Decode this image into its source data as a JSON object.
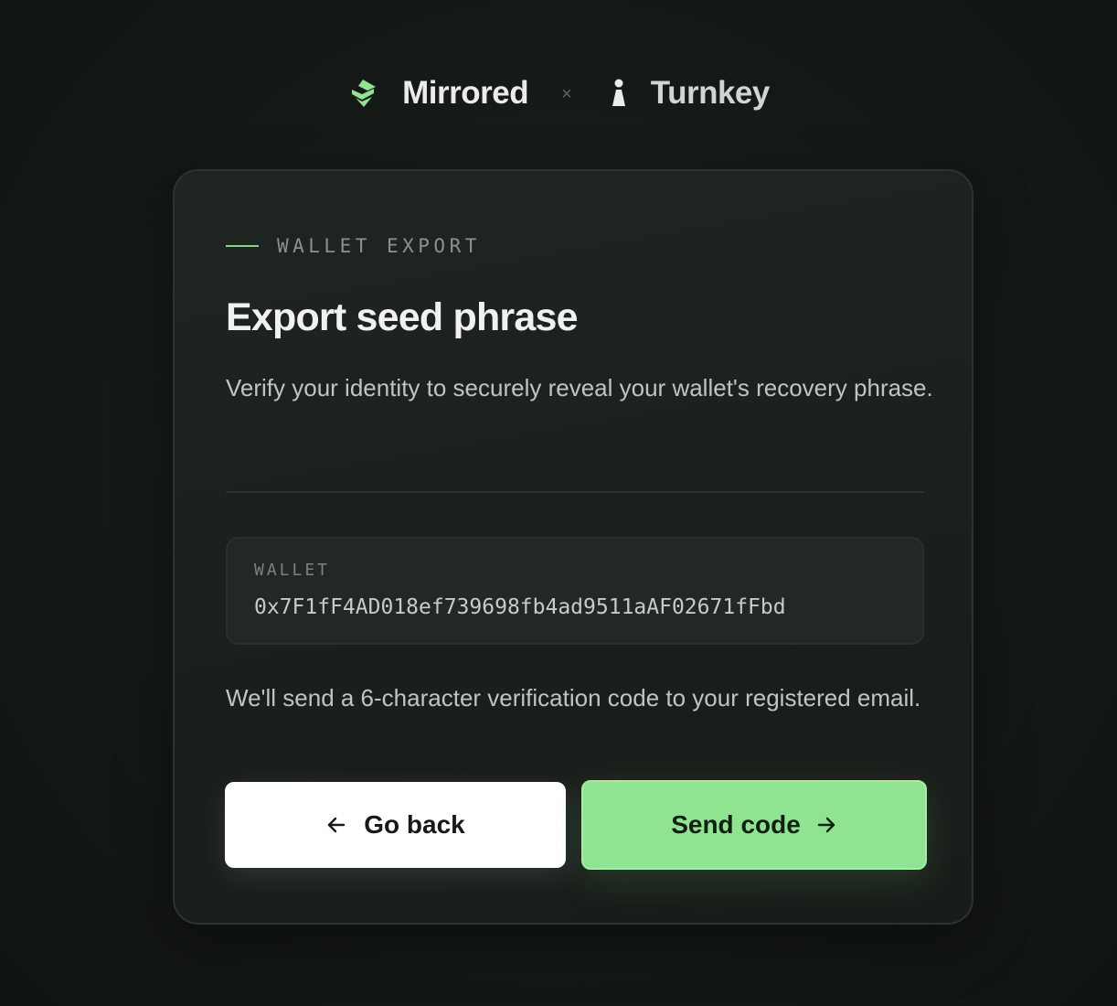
{
  "header": {
    "brand_primary": "Mirrored",
    "separator": "×",
    "brand_secondary": "Turnkey",
    "brand_primary_icon": "mirrored-logo-icon",
    "brand_secondary_icon": "turnkey-logo-icon"
  },
  "card": {
    "eyebrow": "WALLET EXPORT",
    "title": "Export seed phrase",
    "subtitle": "Verify your identity to securely reveal your wallet's recovery phrase.",
    "wallet_label": "WALLET",
    "wallet_address": "0x7F1fF4AD018ef739698fb4ad9511aAF02671fFbd",
    "info": "We'll send a 6-character verification code to your registered email."
  },
  "actions": {
    "back_label": "Go back",
    "back_icon": "arrow-left-icon",
    "send_label": "Send code",
    "send_icon": "arrow-right-icon"
  },
  "colors": {
    "accent": "#8fe391",
    "background": "#141915",
    "card": "#1d231f"
  }
}
